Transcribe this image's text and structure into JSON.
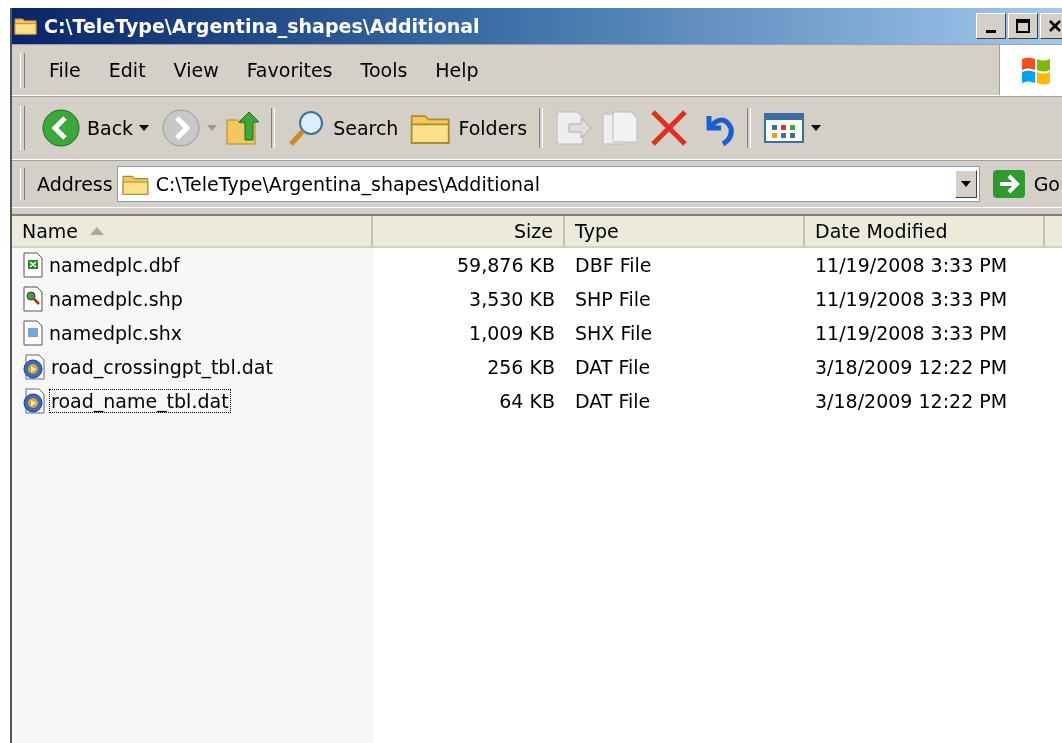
{
  "window": {
    "title": "C:\\TeleType\\Argentina_shapes\\Additional"
  },
  "menu": [
    "File",
    "Edit",
    "View",
    "Favorites",
    "Tools",
    "Help"
  ],
  "toolbar": {
    "back": "Back",
    "search": "Search",
    "folders": "Folders"
  },
  "address": {
    "label": "Address",
    "value": "C:\\TeleType\\Argentina_shapes\\Additional",
    "go": "Go"
  },
  "columns": [
    {
      "label": "Name",
      "sorted": true
    },
    {
      "label": "Size",
      "sorted": false
    },
    {
      "label": "Type",
      "sorted": false
    },
    {
      "label": "Date Modified",
      "sorted": false
    }
  ],
  "files": [
    {
      "name": "namedplc.dbf",
      "kind": "dbf",
      "size": "59,876 KB",
      "type": "DBF File",
      "modified": "11/19/2008 3:33 PM",
      "focused": false
    },
    {
      "name": "namedplc.shp",
      "kind": "shp",
      "size": "3,530 KB",
      "type": "SHP File",
      "modified": "11/19/2008 3:33 PM",
      "focused": false
    },
    {
      "name": "namedplc.shx",
      "kind": "shx",
      "size": "1,009 KB",
      "type": "SHX File",
      "modified": "11/19/2008 3:33 PM",
      "focused": false
    },
    {
      "name": "road_crossingpt_tbl.dat",
      "kind": "dat",
      "size": "256 KB",
      "type": "DAT File",
      "modified": "3/18/2009 12:22 PM",
      "focused": false
    },
    {
      "name": "road_name_tbl.dat",
      "kind": "dat",
      "size": "64 KB",
      "type": "DAT File",
      "modified": "3/18/2009 12:22 PM",
      "focused": true
    }
  ]
}
